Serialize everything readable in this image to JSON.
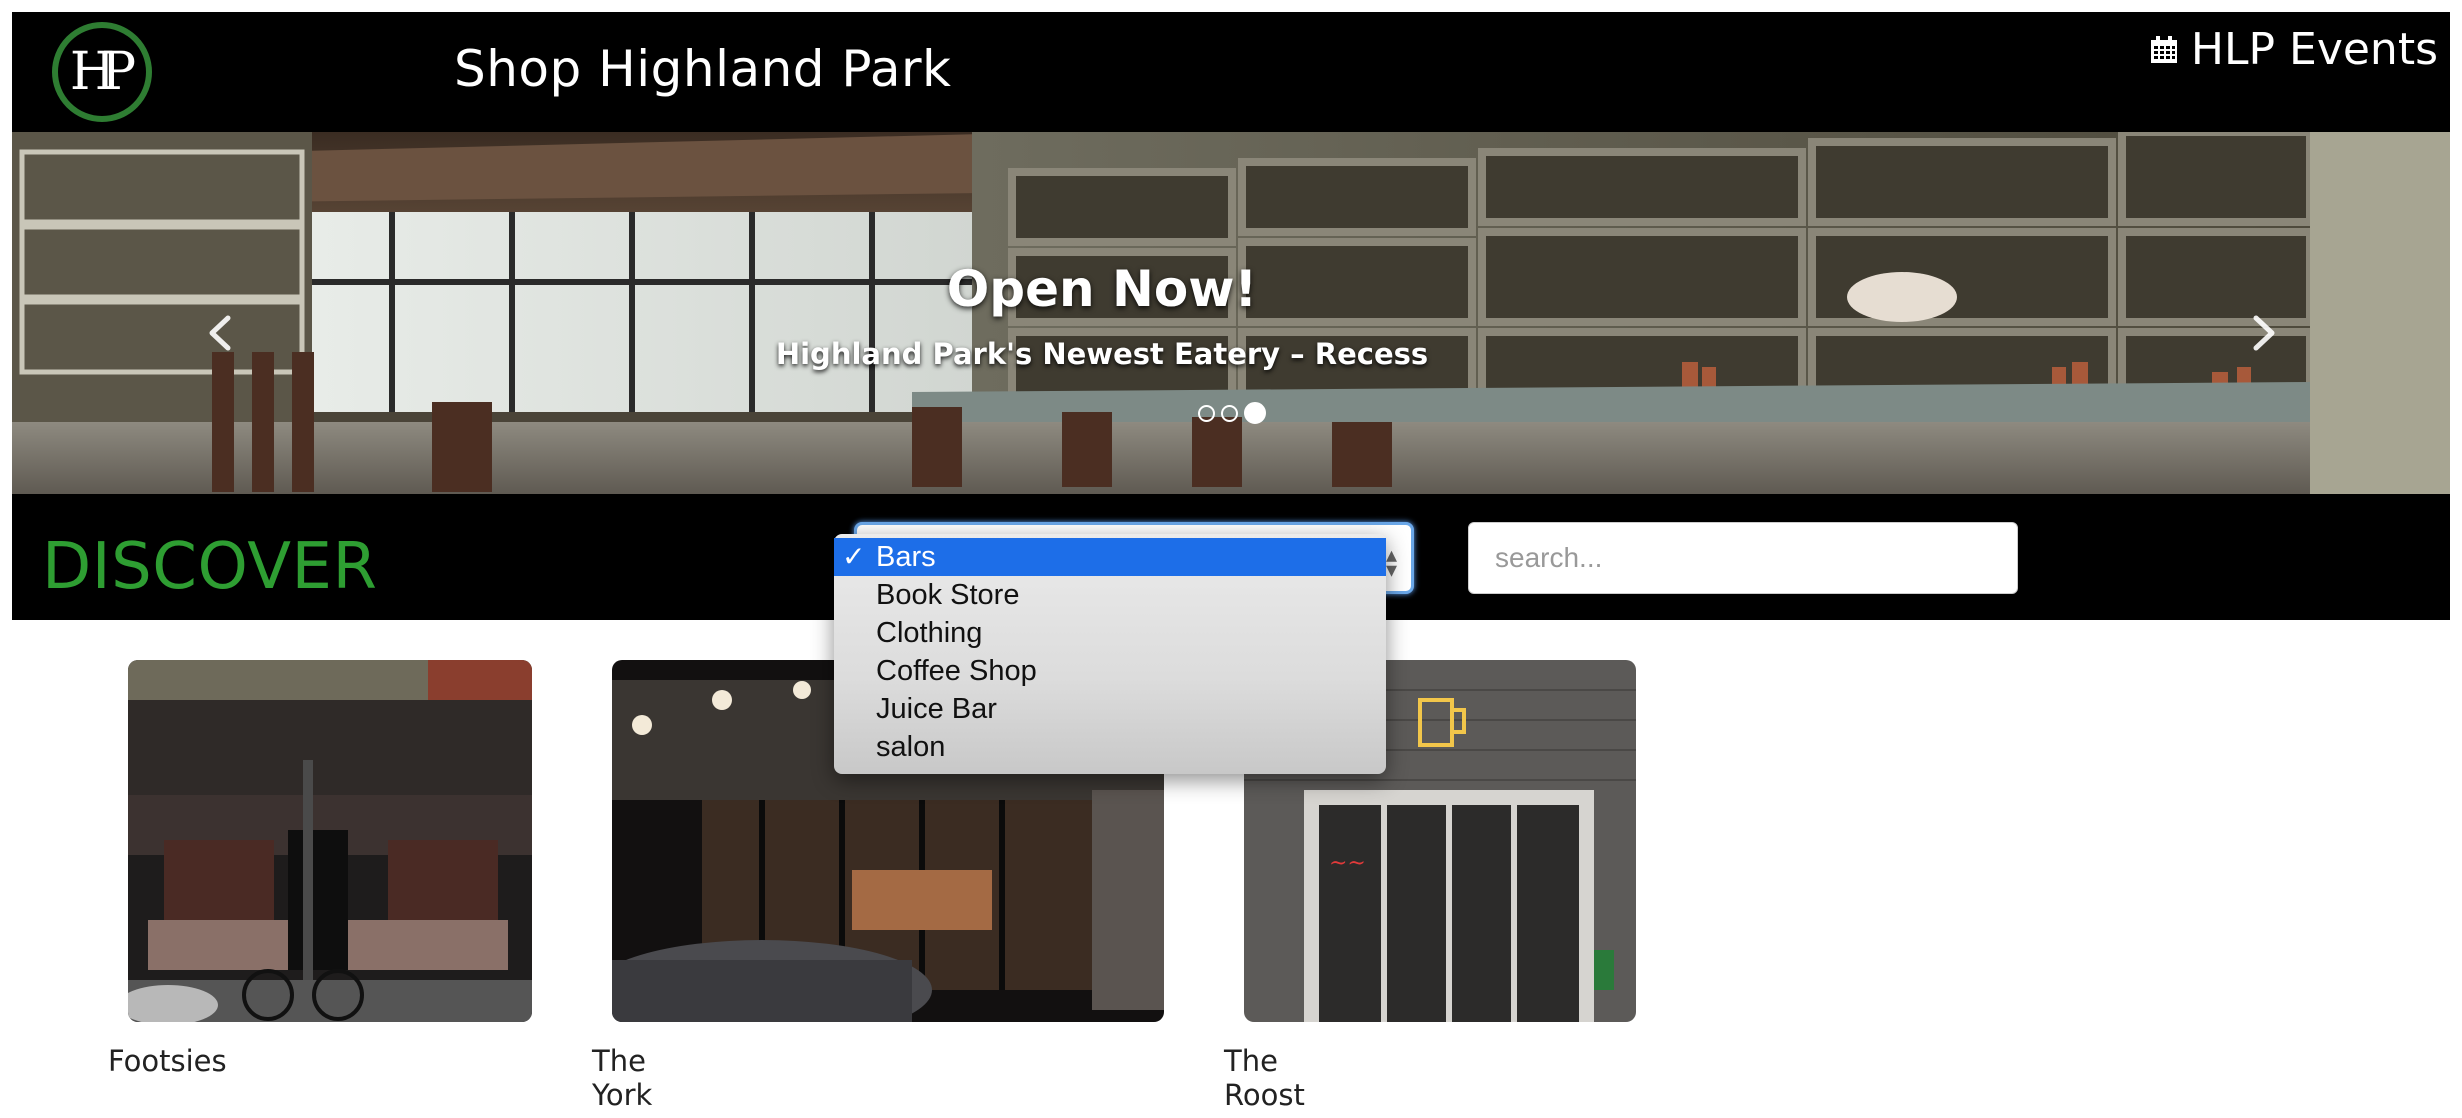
{
  "header": {
    "logo_text": "HP",
    "site_title": "Shop Highland Park",
    "events_label": "HLP Events",
    "events_icon": "calendar-icon"
  },
  "carousel": {
    "heading": "Open Now!",
    "subheading": "Highland Park's Newest Eatery – Recess",
    "slide_count": 3,
    "active_slide": 3,
    "prev_icon": "chevron-left-icon",
    "next_icon": "chevron-right-icon"
  },
  "discover": {
    "title": "DISCOVER",
    "category_select": {
      "selected": "Bars",
      "options": [
        "Bars",
        "Book Store",
        "Clothing",
        "Coffee Shop",
        "Juice Bar",
        "salon"
      ]
    },
    "search": {
      "placeholder": "search...",
      "value": ""
    }
  },
  "shops": [
    {
      "name": "Footsies"
    },
    {
      "name": "The York"
    },
    {
      "name": "The Roost"
    }
  ],
  "colors": {
    "accent_green": "#2e9e32",
    "logo_ring": "#2e7d32",
    "header_bg": "#000000",
    "select_highlight": "#1d6ee8"
  }
}
